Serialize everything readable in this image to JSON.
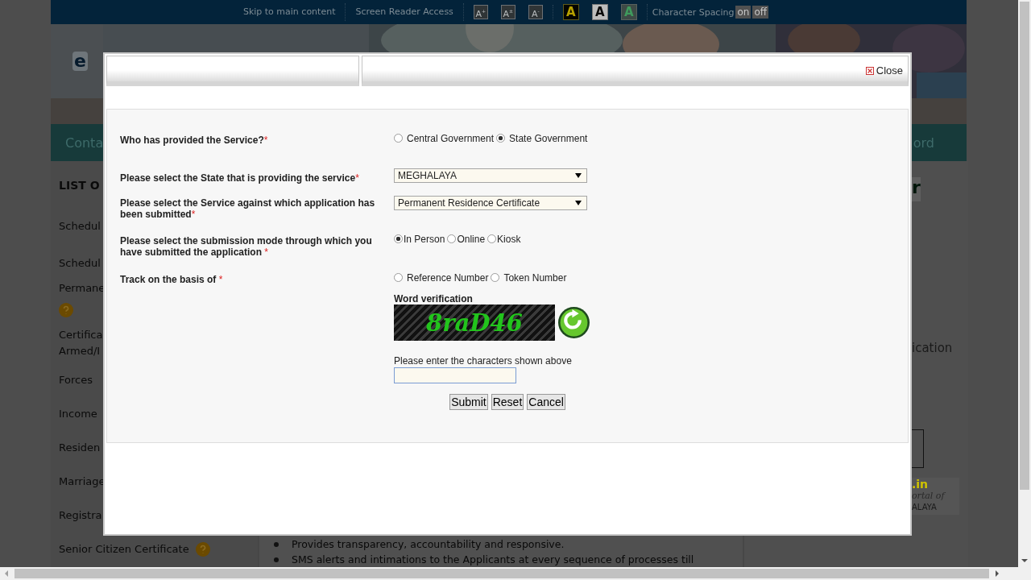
{
  "top_bar": {
    "links": [
      "Skip to main content",
      "Screen Reader Access"
    ],
    "font_size_buttons": [
      "A$^{+}$",
      "A$^{±}$",
      "A$^{-}$"
    ],
    "contrast_buttons": [
      {
        "label": "A",
        "kind": "dark"
      },
      {
        "label": "A",
        "kind": "light"
      },
      {
        "label": "A",
        "kind": "green"
      }
    ],
    "character_spacing": {
      "label": "Character Spacing",
      "buttons": [
        "on",
        "off"
      ]
    }
  },
  "header": {
    "logo_letter": "e"
  },
  "nav": {
    "items": [
      "Conta",
      "ord"
    ]
  },
  "left_column": {
    "heading": "LIST O",
    "items": [
      {
        "kind": "text",
        "lines": [
          "Schedul"
        ]
      },
      {
        "kind": "text",
        "lines": [
          "Schedul"
        ]
      },
      {
        "kind": "help_below",
        "lines": [
          "Permane"
        ]
      },
      {
        "kind": "text",
        "lines": [
          "Certifica",
          "Armed/I"
        ]
      },
      {
        "kind": "text",
        "lines": [
          "Forces"
        ]
      },
      {
        "kind": "text",
        "lines": [
          "Income"
        ]
      },
      {
        "kind": "text",
        "lines": [
          "Residen"
        ]
      },
      {
        "kind": "text",
        "lines": [
          "Marriage"
        ]
      },
      {
        "kind": "text",
        "lines": [
          "Registra"
        ]
      },
      {
        "kind": "help_inline",
        "lines": [
          "Senior Citizen Certificate"
        ]
      }
    ]
  },
  "middle_column": {
    "bullets": [
      "Provides transparency, accountability and responsive.",
      "SMS alerts and intimations to the Applicants at every sequence of processes till"
    ]
  },
  "right_column": {
    "heading": "r",
    "text": "ication",
    "logo": {
      "line_1": ".in",
      "line_2": "ortal of",
      "line_3": "ALAYA"
    }
  },
  "dialog": {
    "close_label": "Close",
    "fields": [
      {
        "kind": "radio",
        "label": "Who has provided the Service?",
        "mark": "*",
        "options": [
          {
            "label": "Central Government",
            "selected": false
          },
          {
            "label": "State Government",
            "selected": true
          }
        ]
      },
      {
        "kind": "select",
        "label": "Please select the State that is providing the service",
        "mark": "*",
        "value": "MEGHALAYA"
      },
      {
        "kind": "select",
        "label": "Please select the Service against which application has been submitted",
        "mark": "*",
        "value": "Permanent Residence Certificate"
      },
      {
        "kind": "radio",
        "label": "Please select the submission mode through which you have submitted the application",
        "mark": " *",
        "options": [
          {
            "label": "In Person",
            "selected": true
          },
          {
            "label": "Online",
            "selected": false
          },
          {
            "label": "Kiosk",
            "selected": false
          }
        ]
      },
      {
        "kind": "radio",
        "label": "Track on the basis of",
        "mark": " *",
        "options": [
          {
            "label": "Reference Number",
            "selected": false
          },
          {
            "label": "Token Number",
            "selected": false
          }
        ]
      }
    ],
    "captcha": {
      "label": "Word verification",
      "code": "8raD46"
    },
    "captcha_input": {
      "label": "Please enter the characters shown above"
    },
    "buttons": [
      "Submit",
      "Reset",
      "Cancel"
    ]
  }
}
